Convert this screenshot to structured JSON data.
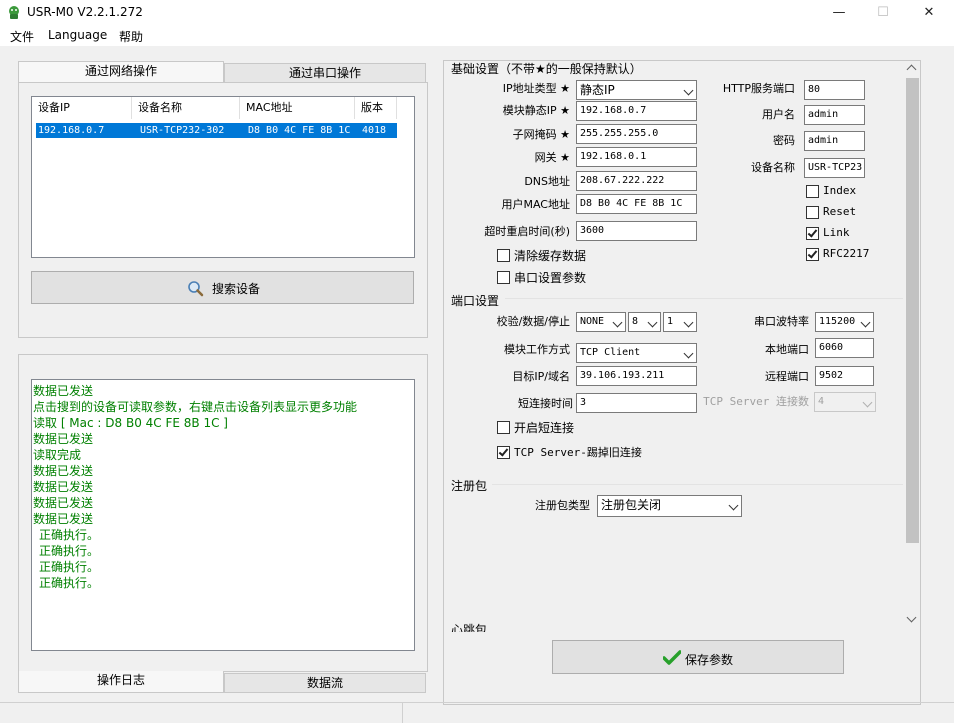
{
  "window": {
    "title": "USR-M0 V2.2.1.272",
    "minimize": "—",
    "maximize": "☐",
    "close": "✕"
  },
  "menu": [
    "文件",
    "Language",
    "帮助"
  ],
  "left": {
    "tabs": [
      "通过网络操作",
      "通过串口操作"
    ],
    "device_table": {
      "columns": [
        "设备IP",
        "设备名称",
        "MAC地址",
        "版本"
      ],
      "rows": [
        [
          "192.168.0.7",
          "USR-TCP232-302",
          "D8 B0 4C FE 8B 1C",
          "4018"
        ]
      ]
    },
    "search_button": "搜索设备",
    "log_lines": [
      "数据已发送",
      "点击搜到的设备可读取参数，右键点击设备列表显示更多功能",
      "读取 [ Mac : D8 B0 4C FE 8B 1C ]",
      "数据已发送",
      "读取完成",
      "数据已发送",
      "数据已发送",
      "数据已发送",
      "数据已发送",
      " 正确执行。",
      " 正确执行。",
      " 正确执行。",
      " 正确执行。"
    ],
    "bottom_tabs": [
      "操作日志",
      "数据流"
    ]
  },
  "basic": {
    "title": "基础设置（不带★的一般保持默认）",
    "star": "★",
    "ip_type_label": "IP地址类型",
    "ip_type_value": "静态IP",
    "static_ip_label": "模块静态IP",
    "static_ip_value": "192.168.0.7",
    "subnet_label": "子网掩码",
    "subnet_value": "255.255.255.0",
    "gateway_label": "网关",
    "gateway_value": "192.168.0.1",
    "dns_label": "DNS地址",
    "dns_value": "208.67.222.222",
    "mac_label": "用户MAC地址",
    "mac_value": "D8 B0 4C FE 8B 1C",
    "timeout_label": "超时重启时间(秒)",
    "timeout_value": "3600",
    "clear_cache_label": "清除缓存数据",
    "serial_params_label": "串口设置参数",
    "http_port_label": "HTTP服务端口",
    "http_port_value": "80",
    "username_label": "用户名",
    "username_value": "admin",
    "password_label": "密码",
    "password_value": "admin",
    "device_name_label": "设备名称",
    "device_name_value": "USR-TCP23",
    "index_label": "Index",
    "reset_label": "Reset",
    "link_label": "Link",
    "rfc_label": "RFC2217"
  },
  "port": {
    "title": "端口设置",
    "parity_label": "校验/数据/停止",
    "parity_value": "NONE",
    "data_bits_value": "8",
    "stop_bits_value": "1",
    "baud_label": "串口波特率",
    "baud_value": "115200",
    "mode_label": "模块工作方式",
    "mode_value": "TCP Client",
    "local_port_label": "本地端口",
    "local_port_value": "6060",
    "target_label": "目标IP/域名",
    "target_value": "39.106.193.211",
    "remote_port_label": "远程端口",
    "remote_port_value": "9502",
    "short_conn_label": "短连接时间",
    "short_conn_value": "3",
    "server_conn_label": "TCP Server 连接数",
    "server_conn_value": "4",
    "enable_short_label": "开启短连接",
    "kick_label": "TCP Server-踢掉旧连接"
  },
  "register": {
    "title": "注册包",
    "type_label": "注册包类型",
    "type_value": "注册包关闭"
  },
  "heartbeat_title": "心跳包",
  "save_button": "保存参数",
  "colors": {
    "selection": "#0078d7",
    "log_text": "#008000",
    "check_green": "#27a02b"
  }
}
